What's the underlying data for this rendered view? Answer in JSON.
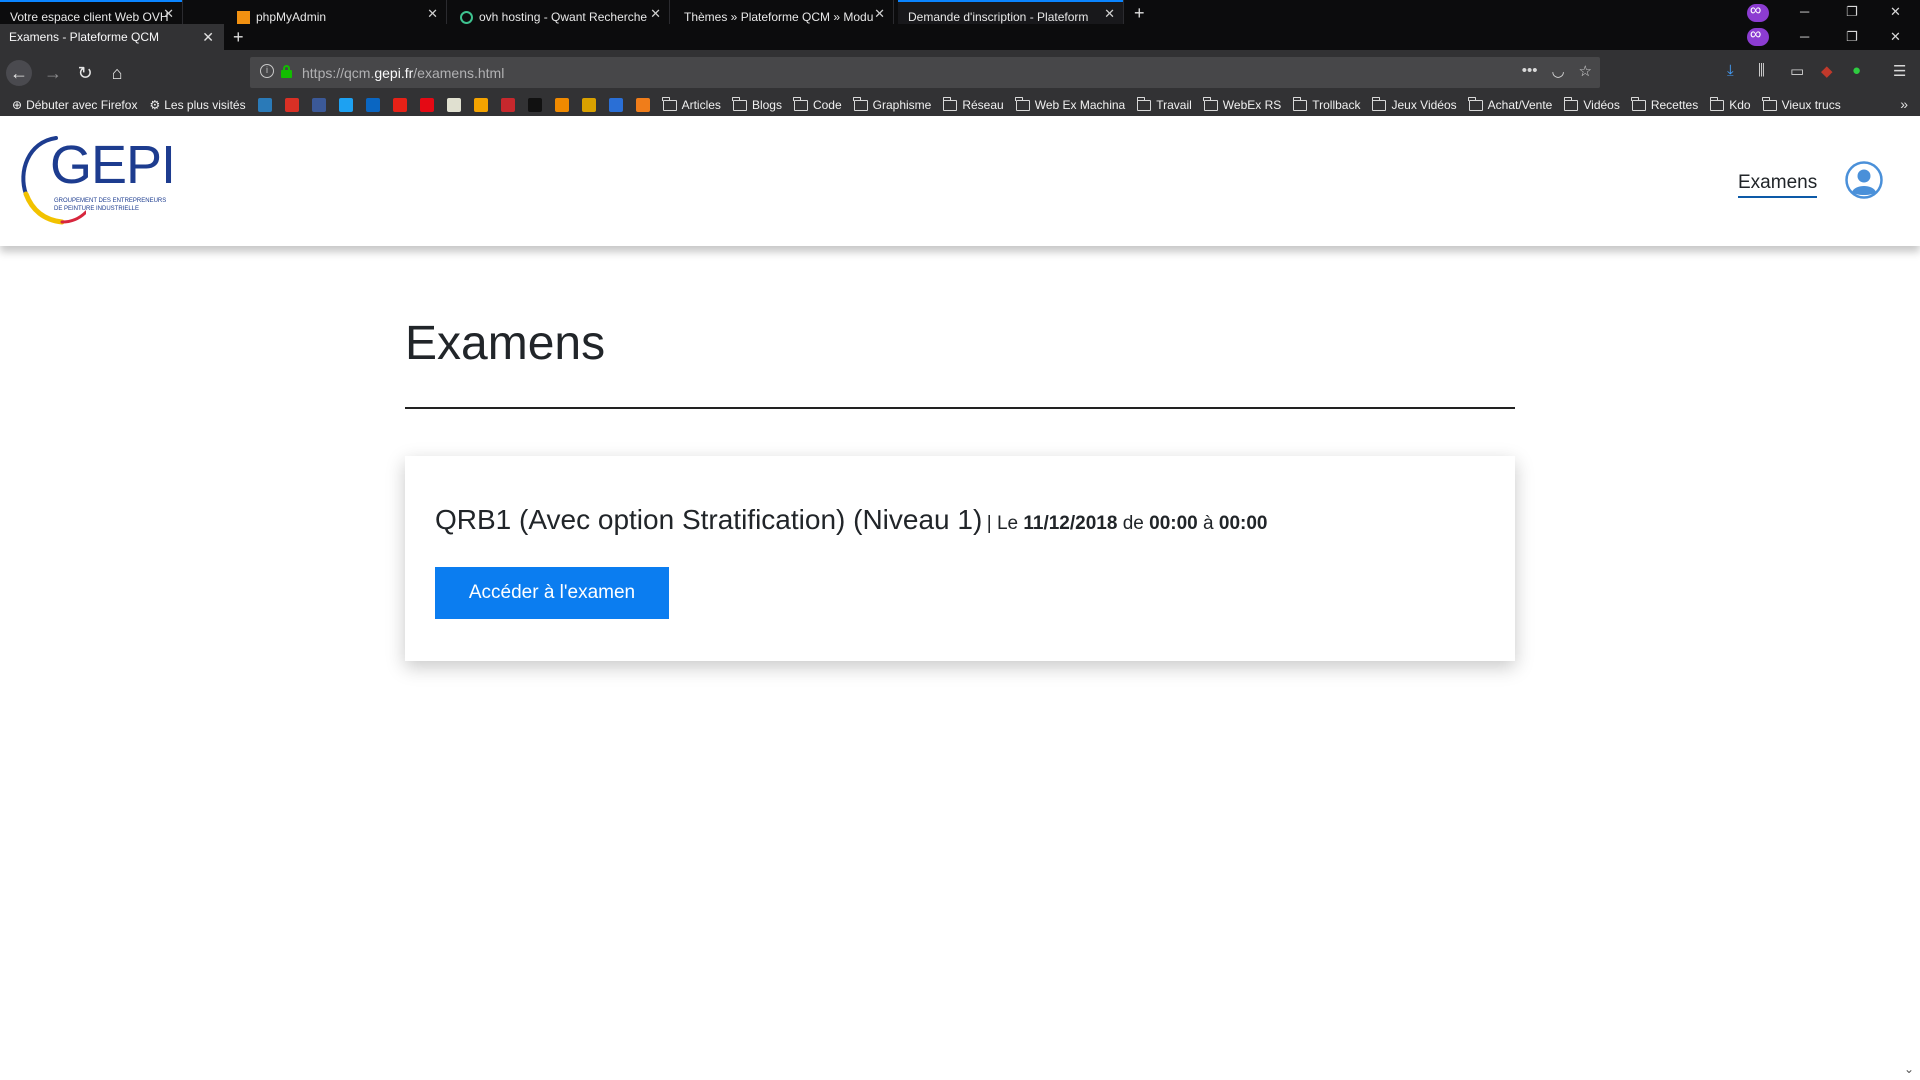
{
  "browser": {
    "background_tabs": [
      {
        "title": "Votre espace client Web OVH"
      },
      {
        "title": "phpMyAdmin"
      },
      {
        "title": "ovh hosting - Qwant Recherche"
      },
      {
        "title": "Thèmes » Plateforme QCM » Modu"
      },
      {
        "title": "Demande d'inscription - Plateform"
      }
    ],
    "active_tab": {
      "title": "Examens - Plateforme QCM"
    },
    "url": {
      "prefix": "https://qcm.",
      "domain": "gepi.fr",
      "path": "/examens.html"
    },
    "bookmarks": {
      "items": [
        {
          "label": "Débuter avec Firefox",
          "icon": "globe-icon"
        },
        {
          "label": "Les plus visités",
          "icon": "gear-icon"
        }
      ],
      "favicons": [
        {
          "color": "#2a7ab8"
        },
        {
          "color": "#d93025"
        },
        {
          "color": "#3b5998"
        },
        {
          "color": "#1da1f2"
        },
        {
          "color": "#0a66c2"
        },
        {
          "color": "#e62117"
        },
        {
          "color": "#e50914"
        },
        {
          "color": "#e0e0d0"
        },
        {
          "color": "#f4a300"
        },
        {
          "color": "#c7282d"
        },
        {
          "color": "#111111"
        },
        {
          "color": "#f08a00"
        },
        {
          "color": "#d9a100"
        },
        {
          "color": "#2a6fd6"
        },
        {
          "color": "#f07d1a"
        }
      ],
      "folders": [
        "Articles",
        "Blogs",
        "Code",
        "Graphisme",
        "Réseau",
        "Web Ex Machina",
        "Travail",
        "WebEx RS",
        "Trollback",
        "Jeux Vidéos",
        "Achat/Vente",
        "Vidéos",
        "Recettes",
        "Kdo",
        "Vieux trucs"
      ]
    }
  },
  "site": {
    "logo": {
      "text": "GEPI",
      "sub1": "GROUPEMENT DES ENTREPRENEURS",
      "sub2": "DE PEINTURE INDUSTRIELLE"
    },
    "nav": {
      "examens_label": "Examens"
    },
    "colors": {
      "brand_blue": "#1d3c8f",
      "button": "#0b7df0",
      "nav_underline": "#0d5aa7"
    }
  },
  "main": {
    "title": "Examens",
    "exam": {
      "name": "QRB1 (Avec option Stratification) (Niveau 1)",
      "sep": "|",
      "le": "Le",
      "date": "11/12/2018",
      "de": "de",
      "start": "00:00",
      "a": "à",
      "end": "00:00",
      "button_label": "Accéder à l'examen"
    }
  }
}
